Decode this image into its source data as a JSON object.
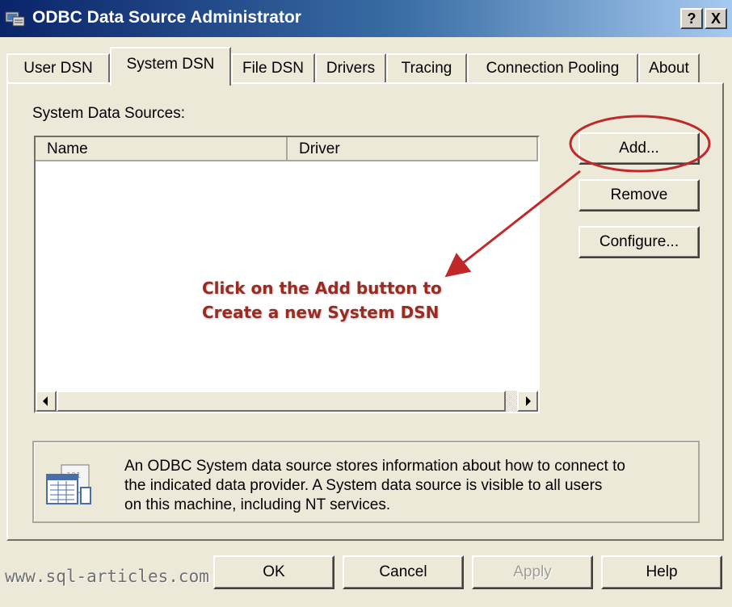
{
  "window": {
    "title": "ODBC Data Source Administrator",
    "help_btn": "?",
    "close_btn": "X"
  },
  "tabs": [
    {
      "label": "User DSN"
    },
    {
      "label": "System DSN"
    },
    {
      "label": "File DSN"
    },
    {
      "label": "Drivers"
    },
    {
      "label": "Tracing"
    },
    {
      "label": "Connection Pooling"
    },
    {
      "label": "About"
    }
  ],
  "active_tab": "System DSN",
  "system_dsn": {
    "section_label": "System Data Sources:",
    "columns": [
      "Name",
      "Driver"
    ],
    "rows": [],
    "buttons": {
      "add": "Add...",
      "remove": "Remove",
      "configure": "Configure..."
    },
    "info_lines": [
      "An ODBC System data source stores information about how to connect to",
      "the indicated data provider.   A System data source is visible to all users",
      "on this machine, including NT services."
    ]
  },
  "dialog_buttons": {
    "ok": "OK",
    "cancel": "Cancel",
    "apply": "Apply",
    "help": "Help"
  },
  "annotation": {
    "lines": [
      "Click on the Add button to",
      "Create a new System DSN"
    ],
    "color": "#c0282a"
  },
  "watermark": "www.sql-articles.com"
}
